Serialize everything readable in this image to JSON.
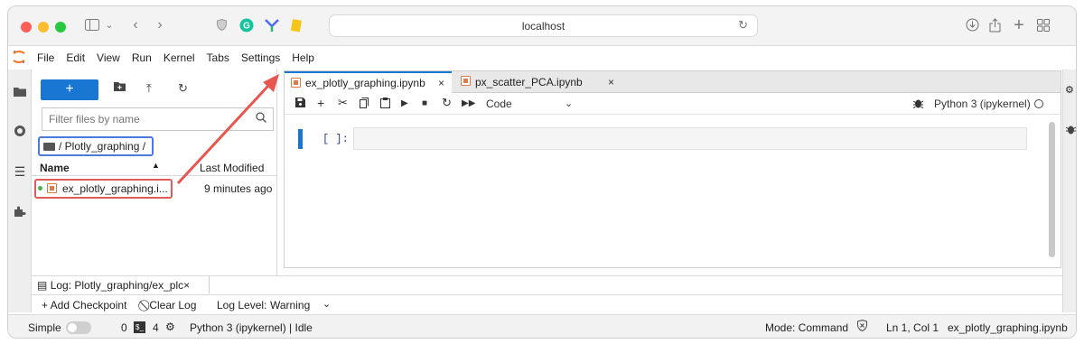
{
  "browser": {
    "url": "localhost",
    "colors": {
      "close": "#fe5f57",
      "minimize": "#febc2e",
      "zoom": "#28c840",
      "accent": "#1976d2",
      "highlight_red": "#df5b57",
      "highlight_blue": "#4a7bd8"
    }
  },
  "menubar": [
    "File",
    "Edit",
    "View",
    "Run",
    "Kernel",
    "Tabs",
    "Settings",
    "Help"
  ],
  "filebrowser": {
    "new_label": "+",
    "filter_placeholder": "Filter files by name",
    "breadcrumb": "/ Plotly_graphing /",
    "col_name": "Name",
    "col_modified": "Last Modified",
    "files": [
      {
        "name": "ex_plotly_graphing.i...",
        "modified": "9 minutes ago"
      }
    ]
  },
  "tabs": [
    {
      "label": "ex_plotly_graphing.ipynb",
      "close": "×"
    },
    {
      "label": "px_scatter_PCA.ipynb",
      "close": "×"
    }
  ],
  "notebook": {
    "cell_type": "Code",
    "kernel": "Python 3 (ipykernel)",
    "prompt": "[ ]:"
  },
  "log": {
    "tab_label": "Log: Plotly_graphing/ex_plc",
    "tab_close": "×",
    "add_checkpoint": "+ Add Checkpoint",
    "clear_log": "Clear Log",
    "log_level_label": "Log Level:",
    "log_level_value": "Warning"
  },
  "statusbar": {
    "mode_label": "Simple",
    "terminals": "0",
    "kernels": "4",
    "kernel_status": "Python 3 (ipykernel) | Idle",
    "mode": "Mode: Command",
    "position": "Ln 1, Col 1",
    "filename": "ex_plotly_graphing.ipynb"
  }
}
